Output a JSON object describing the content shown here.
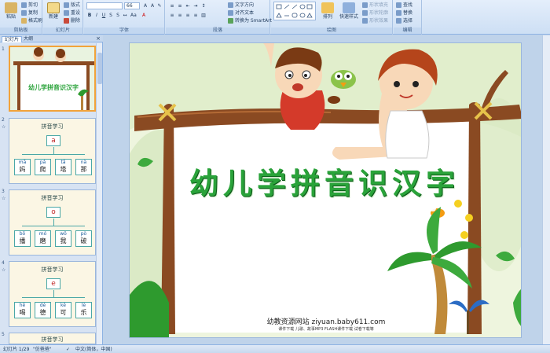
{
  "ribbon": {
    "clipboard": {
      "paste": "粘贴",
      "cut": "剪切",
      "copy": "复制",
      "format_painter": "格式刷",
      "group": "剪贴板"
    },
    "slides": {
      "new_slide": "新建\n幻灯片",
      "layout": "版式",
      "reset": "重设",
      "delete": "删除",
      "group": "幻灯片"
    },
    "font": {
      "font_name": "",
      "font_size": "66",
      "group": "字体"
    },
    "paragraph": {
      "text_direction": "文字方向",
      "align_text": "对齐文本",
      "smartart": "转换为 SmartArt",
      "group": "段落"
    },
    "drawing": {
      "arrange": "排列",
      "quick_styles": "快速样式",
      "shape_fill": "形状填充",
      "shape_outline": "形状轮廓",
      "shape_effects": "形状效果",
      "group": "绘图"
    },
    "editing": {
      "find": "查找",
      "replace": "替换",
      "select": "选择",
      "group": "编辑"
    }
  },
  "panel": {
    "tab_slides": "幻灯片",
    "tab_outline": "大纲",
    "close": "×"
  },
  "thumbnails": [
    {
      "num": "1",
      "title": "幼儿学拼音识汉字",
      "selected": true
    },
    {
      "num": "2",
      "title": "拼音学习",
      "letter": "a",
      "boxes": [
        {
          "py": "mā",
          "hz": "妈"
        },
        {
          "py": "pá",
          "hz": "爬"
        },
        {
          "py": "tǎ",
          "hz": "塔"
        },
        {
          "py": "nà",
          "hz": "那"
        }
      ]
    },
    {
      "num": "3",
      "title": "拼音学习",
      "letter": "o",
      "boxes": [
        {
          "py": "bō",
          "hz": "播"
        },
        {
          "py": "mó",
          "hz": "磨"
        },
        {
          "py": "wǒ",
          "hz": "我"
        },
        {
          "py": "pò",
          "hz": "破"
        }
      ]
    },
    {
      "num": "4",
      "title": "拼音学习",
      "letter": "e",
      "boxes": [
        {
          "py": "hē",
          "hz": "喝"
        },
        {
          "py": "dé",
          "hz": "德"
        },
        {
          "py": "kě",
          "hz": "可"
        },
        {
          "py": "lè",
          "hz": "乐"
        }
      ]
    },
    {
      "num": "5",
      "title": "拼音学习"
    }
  ],
  "slide": {
    "title": "幼儿学拼音识汉字",
    "site": "幼教资源网站  ziyuan.baby611.com",
    "site_sub": "课件下载   儿歌、故事MP3   FLASH课件下载   试卷下载等"
  },
  "status": {
    "slide_pos": "幻灯片 1/29",
    "theme": "\"仿爸爸\"",
    "language": "中文(简体，中国)"
  },
  "colors": {
    "title_green": "#2aa33a",
    "branch_brown": "#8a4a22",
    "selected_border": "#f2a33a"
  }
}
